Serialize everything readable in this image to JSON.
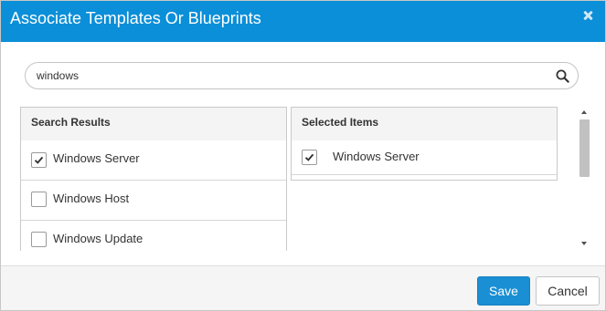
{
  "dialog": {
    "title": "Associate Templates Or Blueprints",
    "close_icon": "close-icon"
  },
  "search": {
    "value": "windows",
    "icon": "search-icon"
  },
  "search_results": {
    "header": "Search Results",
    "items": [
      {
        "label": "Windows Server",
        "checked": true
      },
      {
        "label": "Windows Host",
        "checked": false
      },
      {
        "label": "Windows Update",
        "checked": false
      }
    ]
  },
  "selected_items": {
    "header": "Selected Items",
    "items": [
      {
        "label": "Windows Server",
        "checked": true
      }
    ]
  },
  "footer": {
    "save_label": "Save",
    "cancel_label": "Cancel"
  },
  "colors": {
    "header_bg": "#0b8fd8",
    "save_bg": "#1a8fd3"
  }
}
